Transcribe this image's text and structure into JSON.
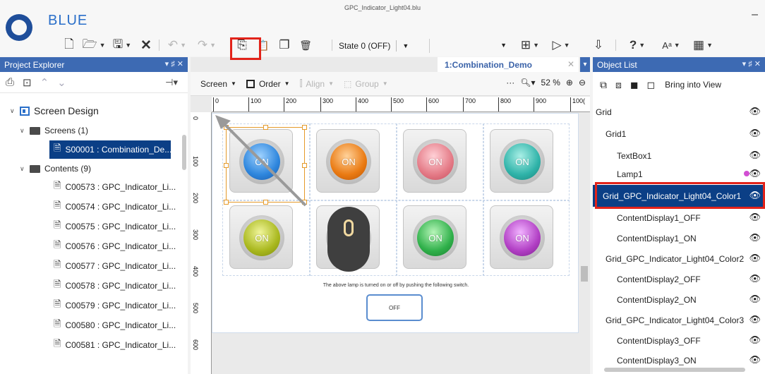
{
  "app": {
    "name": "BLUE",
    "doc_title": "GPC_Indicator_Light04.blu",
    "minimize": "–"
  },
  "toolbar": {
    "new_icon": "🗋",
    "open_icon": "🗁",
    "save_icon": "🖫",
    "close_icon": "✕",
    "undo_icon": "↶",
    "redo_icon": "↷",
    "copy_icon": "⎘",
    "paste_icon": "📋",
    "duplicate_icon": "❐",
    "delete_icon": "🗑",
    "state_label": "State 0 (OFF)",
    "layout_icon": "⊞",
    "run_icon": "▷",
    "transfer_icon": "⇩",
    "help_icon": "?",
    "font_icon": "Aᵃ",
    "grid_icon": "▦"
  },
  "left_panel": {
    "title": "Project Explorer",
    "pin": "▾ ♯ ✕",
    "tree": [
      {
        "label": "Screen Design",
        "kind": "root"
      },
      {
        "label": "Screens (1)",
        "kind": "folder"
      },
      {
        "label": "S00001 : Combination_De...",
        "kind": "screen",
        "selected": true
      },
      {
        "label": "Contents (9)",
        "kind": "folder"
      },
      {
        "label": "C00573 : GPC_Indicator_Li...",
        "kind": "content"
      },
      {
        "label": "C00574 : GPC_Indicator_Li...",
        "kind": "content"
      },
      {
        "label": "C00575 : GPC_Indicator_Li...",
        "kind": "content"
      },
      {
        "label": "C00576 : GPC_Indicator_Li...",
        "kind": "content"
      },
      {
        "label": "C00577 : GPC_Indicator_Li...",
        "kind": "content"
      },
      {
        "label": "C00578 : GPC_Indicator_Li...",
        "kind": "content"
      },
      {
        "label": "C00579 : GPC_Indicator_Li...",
        "kind": "content"
      },
      {
        "label": "C00580 : GPC_Indicator_Li...",
        "kind": "content"
      },
      {
        "label": "C00581 : GPC_Indicator_Li...",
        "kind": "content"
      }
    ]
  },
  "editor": {
    "tab_label": "1:Combination_Demo",
    "screen_label": "Screen",
    "order_label": "Order",
    "align_label": "Align",
    "group_label": "Group",
    "zoom": "52 %",
    "ruler_top": [
      "0",
      "100",
      "200",
      "300",
      "400",
      "500",
      "600",
      "700",
      "800",
      "900",
      "100("
    ],
    "ruler_left": [
      "0",
      "100",
      "200",
      "300",
      "400",
      "500",
      "600"
    ],
    "lamp_text": "ON",
    "lamps": [
      {
        "color": "#2e86dd"
      },
      {
        "color": "#ea7a12"
      },
      {
        "color": "#e47a86"
      },
      {
        "color": "#2fb3a9"
      },
      {
        "color": "#a9b81e"
      },
      {
        "color": "#c7581f"
      },
      {
        "color": "#2fb04a"
      },
      {
        "color": "#b13fc4"
      }
    ],
    "caption": "The above lamp is turned on or off by pushing the following switch.",
    "switch_label": "OFF"
  },
  "right_panel": {
    "title": "Object List",
    "bring_label": "Bring into View",
    "objects": [
      {
        "label": "Grid",
        "indent": 4
      },
      {
        "label": "Grid1",
        "indent": 18
      },
      {
        "label": "TextBox1",
        "indent": 34
      },
      {
        "label": "Lamp1",
        "indent": 34,
        "dot": true
      },
      {
        "label": "Grid_GPC_Indicator_Light04_Color1",
        "indent": 18,
        "selected": true
      },
      {
        "label": "ContentDisplay1_OFF",
        "indent": 34
      },
      {
        "label": "ContentDisplay1_ON",
        "indent": 34
      },
      {
        "label": "Grid_GPC_Indicator_Light04_Color2",
        "indent": 18
      },
      {
        "label": "ContentDisplay2_OFF",
        "indent": 34
      },
      {
        "label": "ContentDisplay2_ON",
        "indent": 34
      },
      {
        "label": "Grid_GPC_Indicator_Light04_Color3",
        "indent": 18
      },
      {
        "label": "ContentDisplay3_OFF",
        "indent": 34
      },
      {
        "label": "ContentDisplay3_ON",
        "indent": 34
      }
    ],
    "eye_icon": "👁"
  },
  "colors": {
    "panel_header": "#3d6ab3",
    "selection": "#0b3f86",
    "highlight": "#e2231a",
    "brand": "#2a6fc9"
  }
}
